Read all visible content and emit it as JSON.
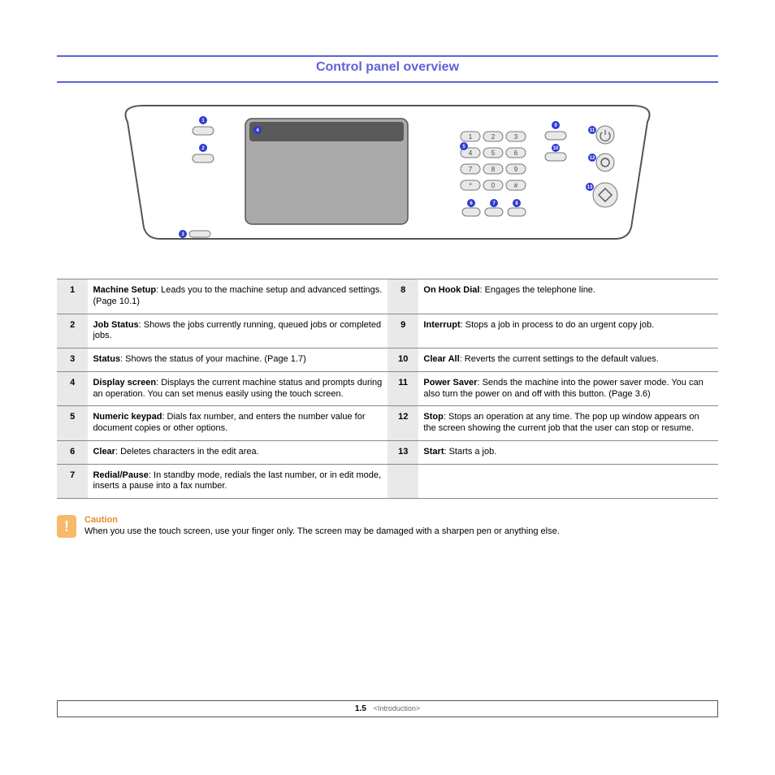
{
  "title": "Control panel overview",
  "keypad": [
    "1",
    "2",
    "3",
    "4",
    "5",
    "6",
    "7",
    "8",
    "9",
    "*",
    "0",
    "#"
  ],
  "callouts": [
    "1",
    "2",
    "3",
    "4",
    "5",
    "6",
    "7",
    "8",
    "9",
    "10",
    "11",
    "12",
    "13"
  ],
  "legend": [
    {
      "n": "1",
      "term": "Machine Setup",
      "desc": ": Leads you to the machine setup and advanced settings. (Page 10.1)"
    },
    {
      "n": "2",
      "term": "Job Status",
      "desc": ": Shows the jobs currently running, queued jobs or completed jobs."
    },
    {
      "n": "3",
      "term": "Status",
      "desc": ": Shows the status of your machine. (Page 1.7)"
    },
    {
      "n": "4",
      "term": "Display screen",
      "desc": ": Displays the current machine status and prompts during an operation. You can set menus easily using the touch screen."
    },
    {
      "n": "5",
      "term": "Numeric keypad",
      "desc": ": Dials fax number, and enters the number value for document copies or other options."
    },
    {
      "n": "6",
      "term": "Clear",
      "desc": ": Deletes characters in the edit area."
    },
    {
      "n": "7",
      "term": "Redial/Pause",
      "desc": ": In standby mode, redials the last number, or in edit mode, inserts a pause into a fax number."
    },
    {
      "n": "8",
      "term": "On Hook Dial",
      "desc": ": Engages the telephone line."
    },
    {
      "n": "9",
      "term": "Interrupt",
      "desc": ": Stops a job in process to do an urgent copy job."
    },
    {
      "n": "10",
      "term": "Clear All",
      "desc": ": Reverts the current settings to the default values."
    },
    {
      "n": "11",
      "term": "Power Saver",
      "desc": ": Sends the machine into the power saver mode. You can also turn the power on and off with this button. (Page 3.6)"
    },
    {
      "n": "12",
      "term": "Stop",
      "desc": ": Stops an operation at any time. The pop up window appears on the screen showing the current job that the user can stop or resume."
    },
    {
      "n": "13",
      "term": "Start",
      "desc": ": Starts a job."
    }
  ],
  "caution": {
    "head": "Caution",
    "body": "When you use the touch screen, use your finger only. The screen may be damaged with a sharpen pen or anything else."
  },
  "footer": {
    "page": "1.5",
    "section": "<Introduction>"
  }
}
